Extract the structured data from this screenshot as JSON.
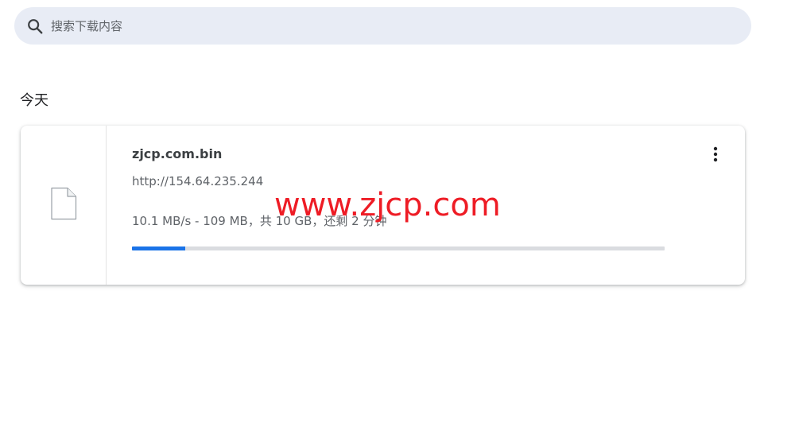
{
  "search": {
    "placeholder": "搜索下载内容",
    "value": "",
    "icon": "search-icon"
  },
  "section": {
    "heading": "今天"
  },
  "download": {
    "file_name": "zjcp.com.bin",
    "url": "http://154.64.235.244",
    "status": "10.1 MB/s - 109 MB，共 10 GB，还剩 2 分钟",
    "progress_fraction": 0.1,
    "file_icon": "file-icon",
    "menu_icon": "more-vert-icon"
  },
  "watermark": {
    "text": "www.zjcp.com"
  },
  "colors": {
    "accent": "#1a73e8",
    "search_bg": "#e8ecf5",
    "watermark": "#ee1c25"
  }
}
